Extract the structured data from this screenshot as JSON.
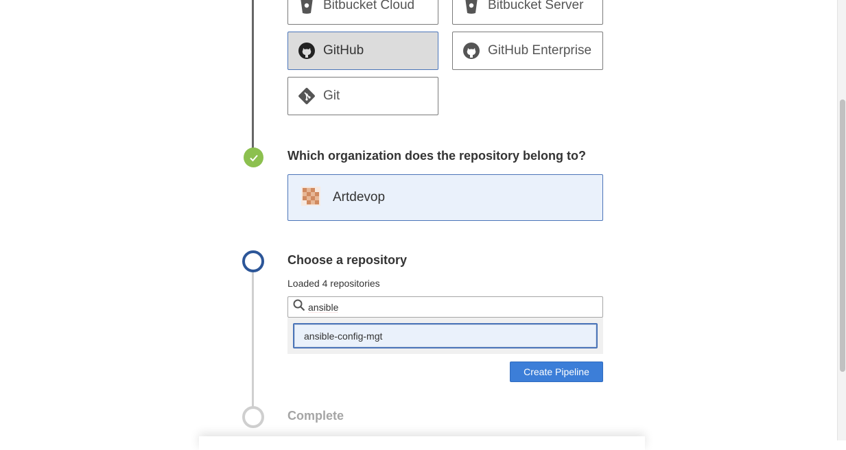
{
  "scm": {
    "options": [
      {
        "label": "Bitbucket Cloud",
        "icon": "bitbucket-icon"
      },
      {
        "label": "Bitbucket Server",
        "icon": "bitbucket-icon"
      },
      {
        "label": "GitHub",
        "icon": "github-icon",
        "selected": true
      },
      {
        "label": "GitHub Enterprise",
        "icon": "github-icon"
      },
      {
        "label": "Git",
        "icon": "git-icon"
      }
    ]
  },
  "org_step": {
    "heading": "Which organization does the repository belong to?",
    "status": "complete",
    "selected_org": "Artdevop",
    "avatar_icon": "org-avatar-icon"
  },
  "repo_step": {
    "heading": "Choose a repository",
    "status": "active",
    "loaded_text": "Loaded 4 repositories",
    "search_value": "ansible",
    "results": [
      "ansible-config-mgt"
    ],
    "create_button": "Create Pipeline"
  },
  "complete_step": {
    "heading": "Complete",
    "status": "pending"
  },
  "colors": {
    "accent": "#3c7ed8",
    "selected_border": "#4a74b8",
    "step_done": "#8cc04f",
    "step_active": "#2c5698",
    "step_pending": "#cfcfcf"
  }
}
